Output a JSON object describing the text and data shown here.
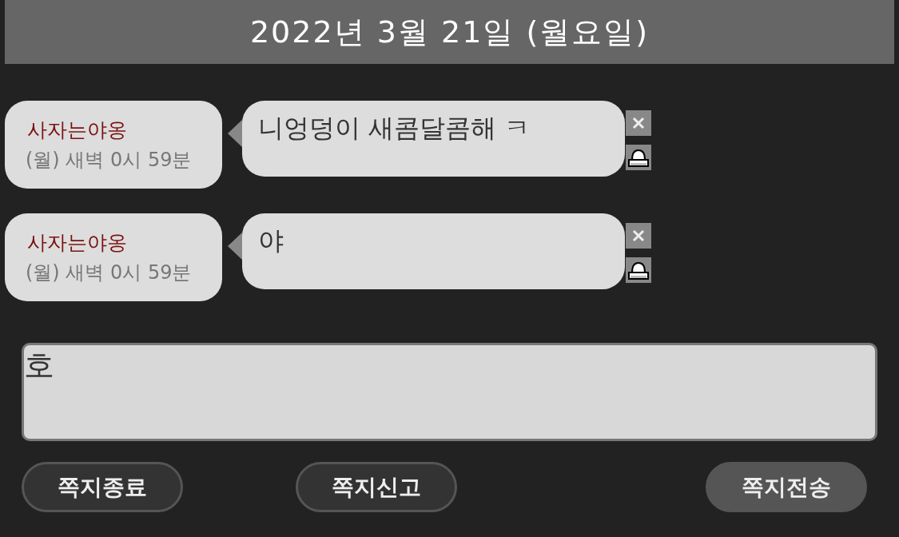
{
  "date_header": "2022년 3월 21일 (월요일)",
  "messages": [
    {
      "sender": "사자는야옹",
      "time": "(월) 새벽 0시 59분",
      "text": "니엉덩이 새콤달콤해 ㅋ"
    },
    {
      "sender": "사자는야옹",
      "time": "(월) 새벽 0시 59분",
      "text": "야"
    }
  ],
  "compose": {
    "value": "호"
  },
  "buttons": [
    {
      "label": "쪽지종료",
      "kind": "normal"
    },
    {
      "label": "쪽지신고",
      "kind": "normal"
    },
    {
      "label": "쪽지전송",
      "kind": "primary"
    }
  ]
}
